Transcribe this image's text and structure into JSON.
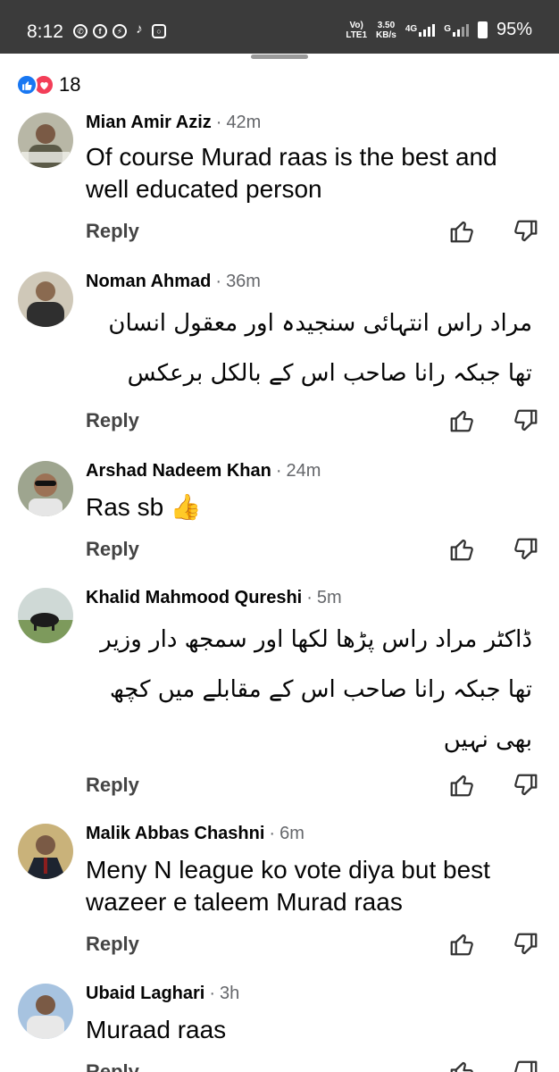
{
  "status_bar": {
    "time": "8:12",
    "volte": "Vo)\nLTE1",
    "speed": "3.50\nKB/s",
    "net1": "4G",
    "net2": "G",
    "battery": "95%"
  },
  "reactions": {
    "count": "18"
  },
  "comments": [
    {
      "name": "Mian Amir Aziz",
      "time": "42m",
      "text": "Of course Murad raas is the best and well educated person",
      "rtl": false,
      "reply": "Reply"
    },
    {
      "name": "Noman Ahmad",
      "time": "36m",
      "text": "مراد راس انتہائی سنجیدہ اور معقول انسان تھا جبکہ رانا صاحب اس کے بالکل برعکس",
      "rtl": true,
      "reply": "Reply"
    },
    {
      "name": "Arshad Nadeem Khan",
      "time": "24m",
      "text": "Ras sb 👍",
      "rtl": false,
      "reply": "Reply"
    },
    {
      "name": "Khalid Mahmood Qureshi",
      "time": "5m",
      "text": "ڈاکٹر مراد راس پڑھا لکھا اور سمجھ دار وزیر تھا جبکہ رانا صاحب اس کے مقابلے میں کچھ بھی نہیں",
      "rtl": true,
      "reply": "Reply"
    },
    {
      "name": "Malik Abbas Chashni",
      "time": "6m",
      "text": "Meny N league ko vote diya but best wazeer e taleem Murad raas",
      "rtl": false,
      "reply": "Reply"
    },
    {
      "name": "Ubaid Laghari",
      "time": "3h",
      "text": "Muraad raas",
      "rtl": false,
      "reply": "Reply"
    }
  ]
}
